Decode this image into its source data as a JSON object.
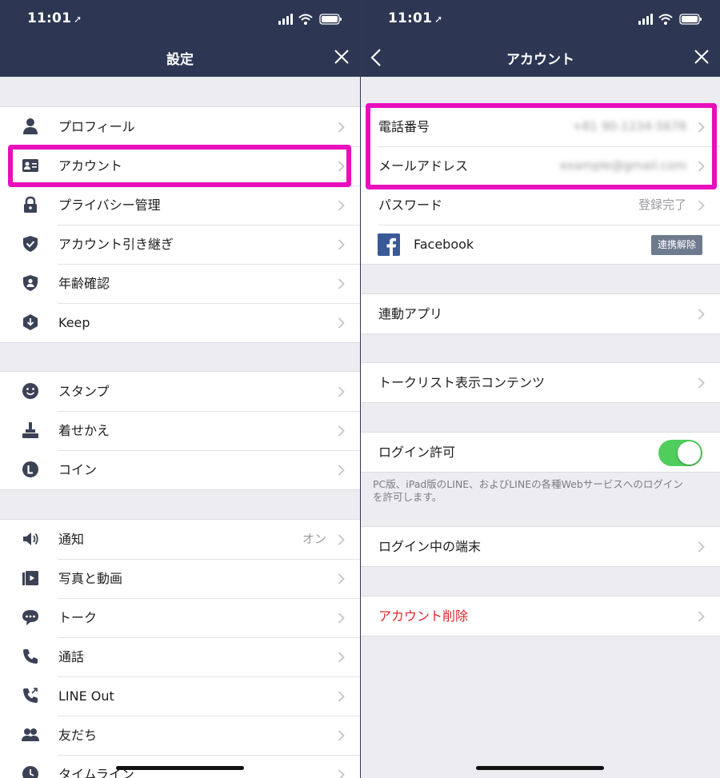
{
  "status_bar": {
    "time": "11:01",
    "location_glyph": "➚"
  },
  "left": {
    "title": "設定",
    "groups": [
      [
        {
          "label": "プロフィール",
          "icon": "person-icon"
        },
        {
          "label": "アカウント",
          "icon": "id-card-icon"
        },
        {
          "label": "プライバシー管理",
          "icon": "lock-icon"
        },
        {
          "label": "アカウント引き継ぎ",
          "icon": "shield-check-icon"
        },
        {
          "label": "年齢確認",
          "icon": "shield-person-icon"
        },
        {
          "label": "Keep",
          "icon": "keep-icon"
        }
      ],
      [
        {
          "label": "スタンプ",
          "icon": "smiley-icon"
        },
        {
          "label": "着せかえ",
          "icon": "theme-brush-icon"
        },
        {
          "label": "コイン",
          "icon": "coin-icon"
        }
      ],
      [
        {
          "label": "通知",
          "icon": "speaker-icon",
          "value": "オン"
        },
        {
          "label": "写真と動画",
          "icon": "photo-video-icon"
        },
        {
          "label": "トーク",
          "icon": "chat-bubble-icon"
        },
        {
          "label": "通話",
          "icon": "phone-icon"
        },
        {
          "label": "LINE Out",
          "icon": "phone-out-icon"
        },
        {
          "label": "友だち",
          "icon": "friends-icon"
        },
        {
          "label": "タイムライン",
          "icon": "clock-icon"
        }
      ]
    ]
  },
  "right": {
    "title": "アカウント",
    "phone": {
      "label": "電話番号",
      "value": "+81 90-1234-5678"
    },
    "email": {
      "label": "メールアドレス",
      "value": "example@gmail.com"
    },
    "password": {
      "label": "パスワード",
      "value": "登録完了"
    },
    "facebook": {
      "label": "Facebook",
      "button": "連携解除"
    },
    "linked_apps": {
      "label": "連動アプリ"
    },
    "talk_list": {
      "label": "トークリスト表示コンテンツ"
    },
    "login_allow": {
      "label": "ログイン許可",
      "on": true
    },
    "login_note_1": "PC版、iPad版のLINE、およびLINEの各種Webサービスへのログイン",
    "login_note_2": "を許可します。",
    "devices": {
      "label": "ログイン中の端末"
    },
    "delete": {
      "label": "アカウント削除",
      "color": "#e0262a"
    }
  },
  "colors": {
    "header": "#2d3753",
    "highlight": "#e80fbd",
    "toggle_on": "#4fce5d",
    "fb": "#3a5999"
  }
}
